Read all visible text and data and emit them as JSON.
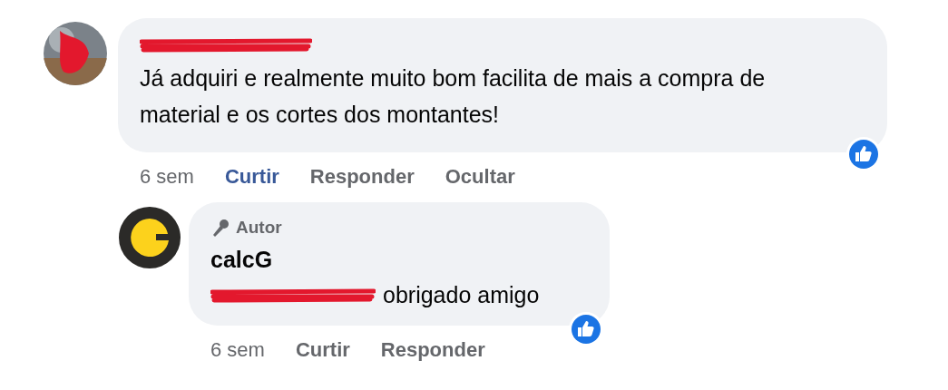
{
  "comments": [
    {
      "text": "Já adquiri e realmente muito bom facilita de mais a compra de material e os cortes dos montantes!",
      "reactions": true,
      "time": "6 sem",
      "actions": [
        {
          "label": "Curtir",
          "selected": true
        },
        {
          "label": "Responder",
          "selected": false
        },
        {
          "label": "Ocultar",
          "selected": false
        }
      ],
      "replies": [
        {
          "badge": "Autor",
          "author": "calcG",
          "mention_redacted": true,
          "text": "obrigado amigo",
          "reactions": true,
          "time": "6 sem",
          "actions": [
            {
              "label": "Curtir",
              "selected": false
            },
            {
              "label": "Responder",
              "selected": false
            }
          ]
        }
      ]
    }
  ]
}
